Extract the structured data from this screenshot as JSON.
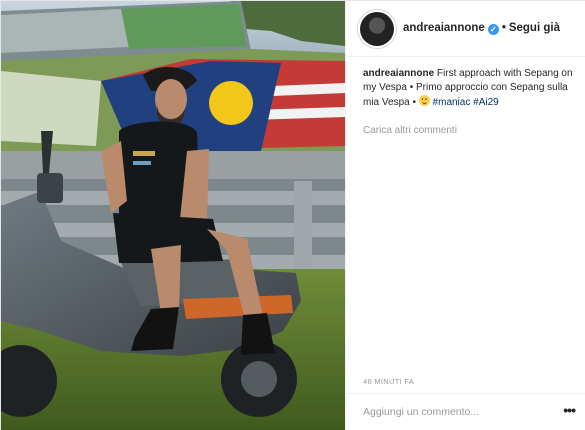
{
  "post": {
    "photo_alt": "Man in black cap and polo sitting on a dark grey scooter at a race track with a Malaysian flag painted on the stand",
    "header": {
      "username": "andreaiannone",
      "verified_glyph": "✓",
      "separator": "•",
      "follow_label": "Segui già"
    },
    "caption": {
      "username": "andreaiannone",
      "text_1": "First approach with Sepang on my Vespa • Primo approccio con Sepang sulla mia Vespa • ",
      "hashtags": [
        "#maniac",
        "#Ai29"
      ]
    },
    "load_more": "Carica altri commenti",
    "timestamp": "46 MINUTI FA",
    "comment_placeholder": "Aggiungi un commento...",
    "menu_glyph": "•••"
  },
  "icons": [
    "verified-badge-icon",
    "smile-emoji-icon",
    "more-options-icon",
    "avatar"
  ],
  "colors": {
    "link": "#003569",
    "verified": "#3897f0",
    "muted": "#999999",
    "text": "#262626"
  }
}
